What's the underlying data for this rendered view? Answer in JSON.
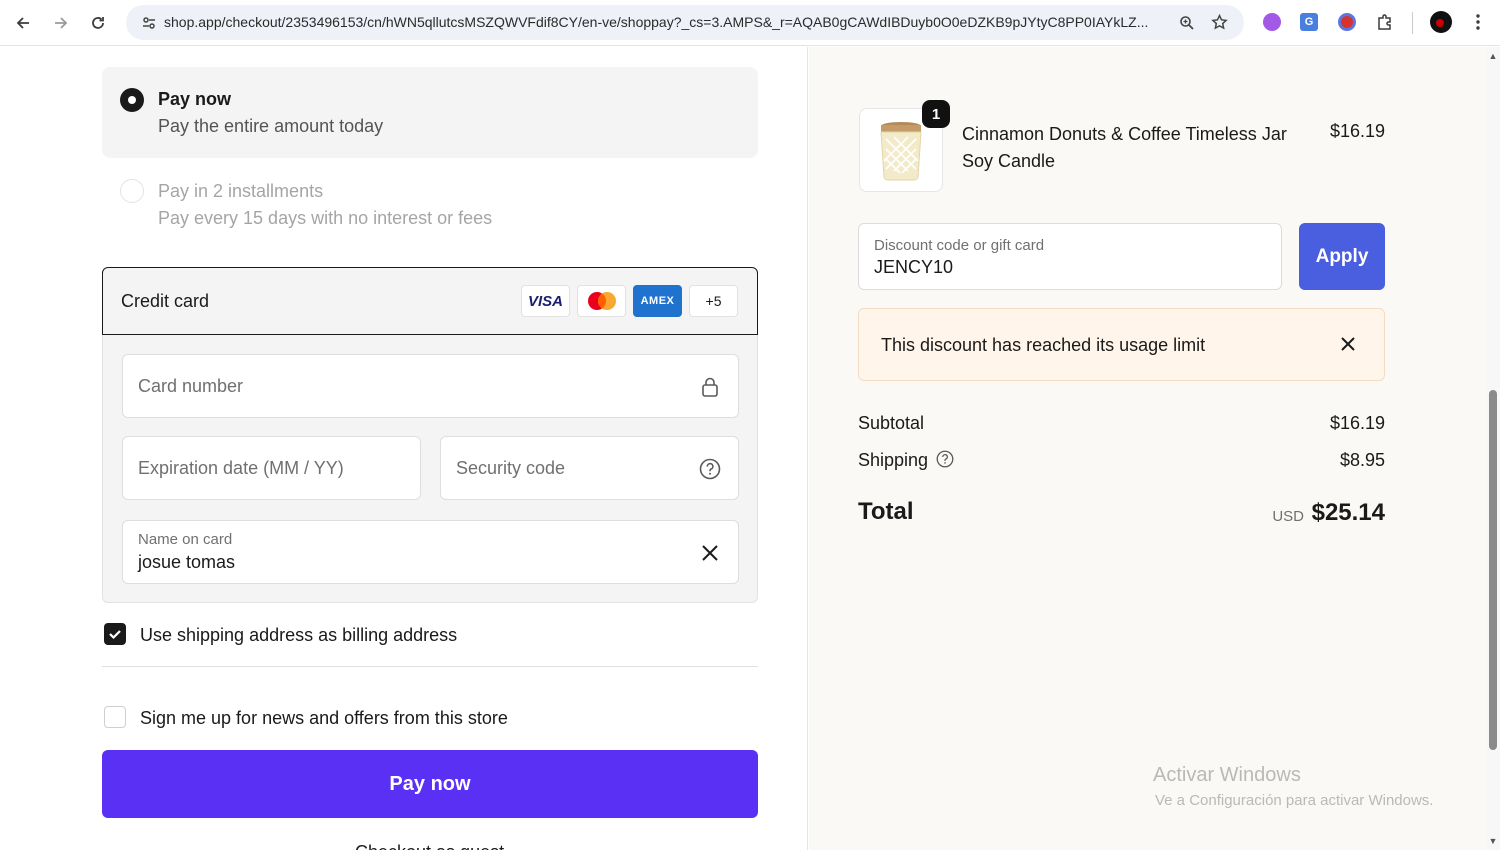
{
  "browser": {
    "url": "shop.app/checkout/2353496153/cn/hWN5qllutcsMSZQWVFdif8CY/en-ve/shoppay?_cs=3.AMPS&_r=AQAB0gCAWdIBDuyb0O0eDZKB9pJYtyC8PP0IAYkLZ..."
  },
  "payment_options": [
    {
      "title": "Pay now",
      "subtitle": "Pay the entire amount today",
      "selected": true
    },
    {
      "title": "Pay in 2 installments",
      "subtitle": "Pay every 15 days with no interest or fees",
      "selected": false
    }
  ],
  "credit_card": {
    "title": "Credit card",
    "brands": [
      "VISA",
      "MASTERCARD",
      "AMEX"
    ],
    "more_brands": "+5",
    "card_number_placeholder": "Card number",
    "expiration_placeholder": "Expiration date (MM / YY)",
    "security_placeholder": "Security code",
    "name_label": "Name on card",
    "name_value": "josue tomas"
  },
  "billing_checkbox": {
    "label": "Use shipping address as billing address",
    "checked": true
  },
  "newsletter_checkbox": {
    "label": "Sign me up for news and offers from this store",
    "checked": false
  },
  "pay_button": "Pay now",
  "cut_off_text": "Checkout as guest",
  "order": {
    "product": {
      "name": "Cinnamon Donuts & Coffee Timeless Jar Soy Candle",
      "price": "$16.19",
      "quantity": "1"
    },
    "discount": {
      "label": "Discount code or gift card",
      "value": "JENCY10",
      "apply": "Apply"
    },
    "alert": "This discount has reached its usage limit",
    "subtotal_label": "Subtotal",
    "subtotal_value": "$16.19",
    "shipping_label": "Shipping",
    "shipping_value": "$8.95",
    "total_label": "Total",
    "total_currency": "USD",
    "total_value": "$25.14"
  },
  "watermark": {
    "title": "Activar Windows",
    "subtitle": "Ve a Configuración para activar Windows."
  },
  "colors": {
    "pay_button": "#5a31f4",
    "apply_button": "#4a5ee0",
    "alert_bg": "#fff5ea"
  }
}
